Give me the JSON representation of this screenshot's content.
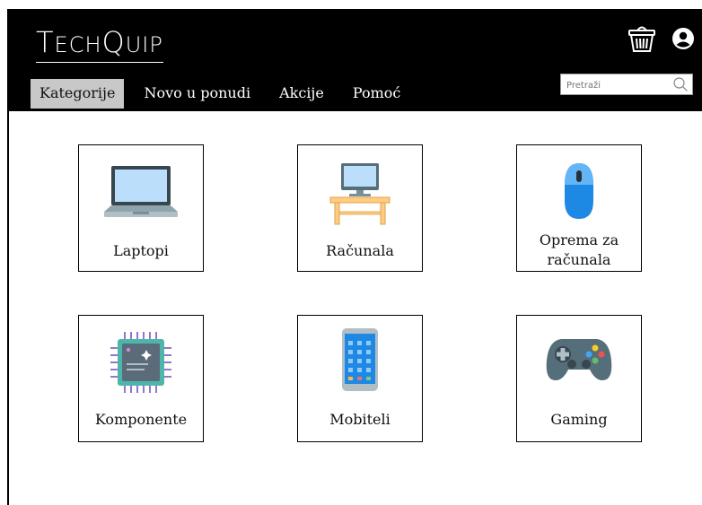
{
  "header": {
    "brand": {
      "first": "T",
      "rest_small": "ECH",
      "q": "Q",
      "end_small": "UIP"
    },
    "nav": [
      {
        "label": "Kategorije",
        "active": true
      },
      {
        "label": "Novo u ponudi",
        "active": false
      },
      {
        "label": "Akcije",
        "active": false
      },
      {
        "label": "Pomoć",
        "active": false
      }
    ],
    "search": {
      "placeholder": "Pretraži"
    },
    "icons": {
      "cart": "basket-icon",
      "user": "user-account-icon"
    }
  },
  "categories": [
    {
      "label": "Laptopi",
      "icon": "laptop-icon"
    },
    {
      "label": "Računala",
      "icon": "desktop-computer-icon"
    },
    {
      "label_line1": "Oprema za",
      "label_line2": "računala",
      "icon": "computer-mouse-icon"
    },
    {
      "label": "Komponente",
      "icon": "microchip-icon"
    },
    {
      "label": "Mobiteli",
      "icon": "smartphone-icon"
    },
    {
      "label": "Gaming",
      "icon": "gamepad-icon"
    }
  ],
  "colors": {
    "header_bg": "#000000",
    "active_tab_bg": "#c8c8c8"
  }
}
